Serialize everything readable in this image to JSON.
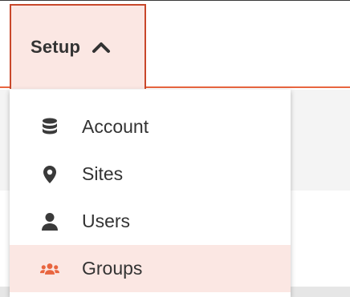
{
  "nav": {
    "setup_label": "Setup",
    "setup_icon": "chevron-up-icon",
    "accent_color": "#c8472a",
    "active_bg": "#fbe7e3"
  },
  "menu": {
    "items": [
      {
        "label": "Account",
        "icon": "database-icon",
        "active": false
      },
      {
        "label": "Sites",
        "icon": "map-pin-icon",
        "active": false
      },
      {
        "label": "Users",
        "icon": "user-icon",
        "active": false
      },
      {
        "label": "Groups",
        "icon": "users-group-icon",
        "active": true
      }
    ]
  }
}
